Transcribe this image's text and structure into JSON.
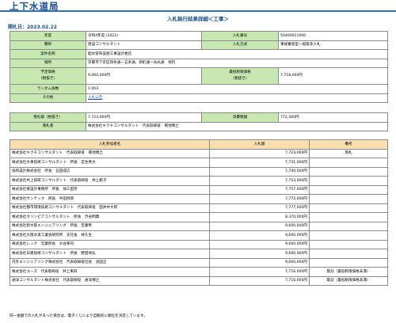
{
  "site": {
    "title": "上下水道局"
  },
  "page": {
    "heading": "入札執行結果詳細＜工事＞",
    "open_date": "開札日：2023.02.22"
  },
  "details": {
    "fiscal_year_label": "年度",
    "fiscal_year": "令和4年度 (2022)",
    "bid_no_label": "入札番号",
    "bid_no": "50400011000",
    "category_label": "種目",
    "category": "建設コンサルタント",
    "bid_method_label": "入札方式",
    "bid_method": "事後審査型一般競争入札",
    "project_name_label": "案件名称",
    "project_name": "配水管布設替工事設計委託",
    "location_label": "場所",
    "location": "京都市下京区四条通一五条通、新町通～烏丸通　地内",
    "planned_price_label": "予定価格",
    "planned_price_note": "（税抜き）",
    "planned_price": "9,060,000円",
    "min_price_label": "最低制限価格",
    "min_price_note": "（税抜き）",
    "min_price": "7,718,000円",
    "random_label": "ランダム係数",
    "random": "1.003",
    "other_label": "その他",
    "other_link": "入札公告"
  },
  "award": {
    "amount_label": "落札額（税抜き）",
    "amount": "7,723,000円",
    "tax_label": "消費税額",
    "tax": "772,300円",
    "winner_label": "落札者",
    "winner": "株式会社キクチコンサルタント　代表取締役　菊地博之"
  },
  "bidders": {
    "headers": [
      "入札参加者名",
      "入札額",
      "備考"
    ],
    "rows": [
      {
        "name": "株式会社キクチコンサルタント　代表取締役　菊地博之",
        "amount": "7,723,000円",
        "note": "落札"
      },
      {
        "name": "株式会社大幸技術コンサルタント　所長　宮生秀文",
        "amount": "7,731,000円",
        "note": ""
      },
      {
        "name": "協和設計株式会社　所長　石田成広",
        "amount": "7,740,000円",
        "note": ""
      },
      {
        "name": "株式会社共上技研コンサルタント　代表取締役　井上範子",
        "amount": "7,753,000円",
        "note": ""
      },
      {
        "name": "株式会社寛設計事務所　所長　加三田宗",
        "amount": "7,757,000円",
        "note": ""
      },
      {
        "name": "株式会社サンテック　所長　牛田悦郎",
        "amount": "7,772,000円",
        "note": ""
      },
      {
        "name": "株式会社都市環境技術コンサルタント　代表取締役　田井中大郎",
        "amount": "7,777,000円",
        "note": ""
      },
      {
        "name": "株式会社オリンピアコンサルタント　所長　渋谷明典",
        "amount": "8,370,000円",
        "note": ""
      },
      {
        "name": "株式会社新大阪エンジニアリング　所長　吉藤隼",
        "amount": "9,600,000円",
        "note": ""
      },
      {
        "name": "株式会社大阪水道工業会研究所　支社長　林久生",
        "amount": "9,600,000円",
        "note": ""
      },
      {
        "name": "株式会社レック　営業所長　大谷幸司",
        "amount": "9,660,000円",
        "note": ""
      },
      {
        "name": "株式会社日建技術コンサルタント　所長　野田修弘",
        "amount": "9,660,000円",
        "note": ""
      },
      {
        "name": "内外エンジニアリング株式会社　代表取締役社長　池田正",
        "amount": "9,660,000円",
        "note": ""
      },
      {
        "name": "株式会社ユーズ　代表取締役　井上東四",
        "amount": "7,716,000円",
        "note": "無効（最低制限価格未満）"
      },
      {
        "name": "通洋コンサルタント株式会社　代表取締役　通洋博之",
        "amount": "7,716,000円",
        "note": "無効（最低制限価格未満）"
      }
    ]
  },
  "footnote": "同一金額での入札があった場合は、電子くじにより自動的に順位を決定しています。"
}
